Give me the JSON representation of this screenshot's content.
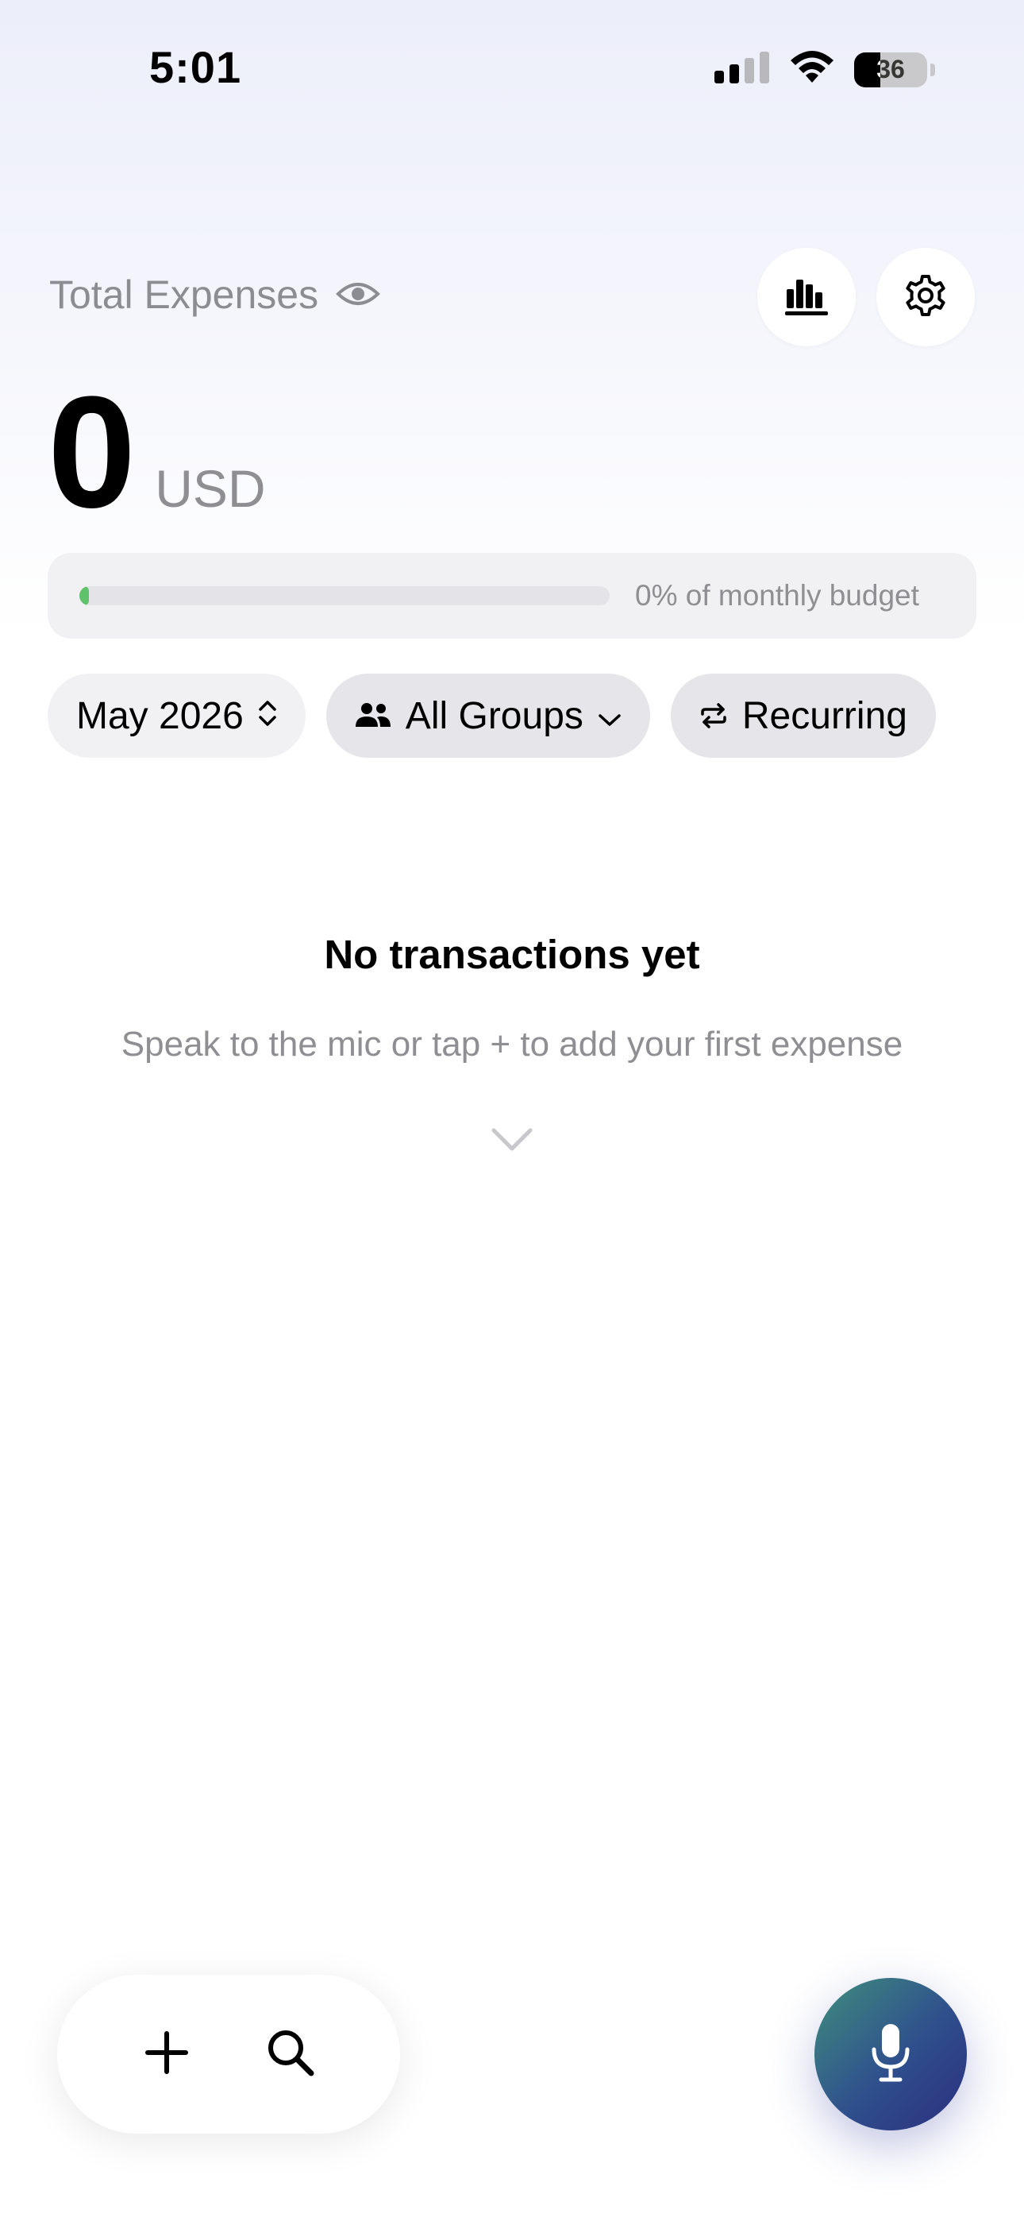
{
  "status_bar": {
    "time": "5:01",
    "battery_level": 36,
    "battery_text": "36",
    "icons": [
      "cellular-signal-icon",
      "wifi-icon",
      "battery-icon"
    ]
  },
  "header": {
    "title": "Total Expenses",
    "icons": [
      "eye-icon",
      "bar-chart-icon",
      "gear-icon"
    ]
  },
  "amount": {
    "value": "0",
    "currency": "USD"
  },
  "budget": {
    "percent_used": 0,
    "label": "0% of monthly budget",
    "fill_color": "#5ec26a"
  },
  "filters": {
    "month_label": "May 2026",
    "groups_label": "All Groups",
    "recurring_label": "Recurring",
    "icons": [
      "up-down-chevron-icon",
      "people-icon",
      "chevron-down-icon",
      "repeat-icon"
    ]
  },
  "empty_state": {
    "title": "No transactions yet",
    "subtitle": "Speak to the mic or tap + to add your first expense",
    "icon": "chevron-down-icon"
  },
  "toolbar": {
    "icons": [
      "plus-icon",
      "search-icon",
      "microphone-icon"
    ]
  },
  "colors": {
    "accent_gradient_start": "#3f8f7e",
    "accent_gradient_end": "#2b2e7e",
    "secondary_text": "#8e8e93"
  }
}
